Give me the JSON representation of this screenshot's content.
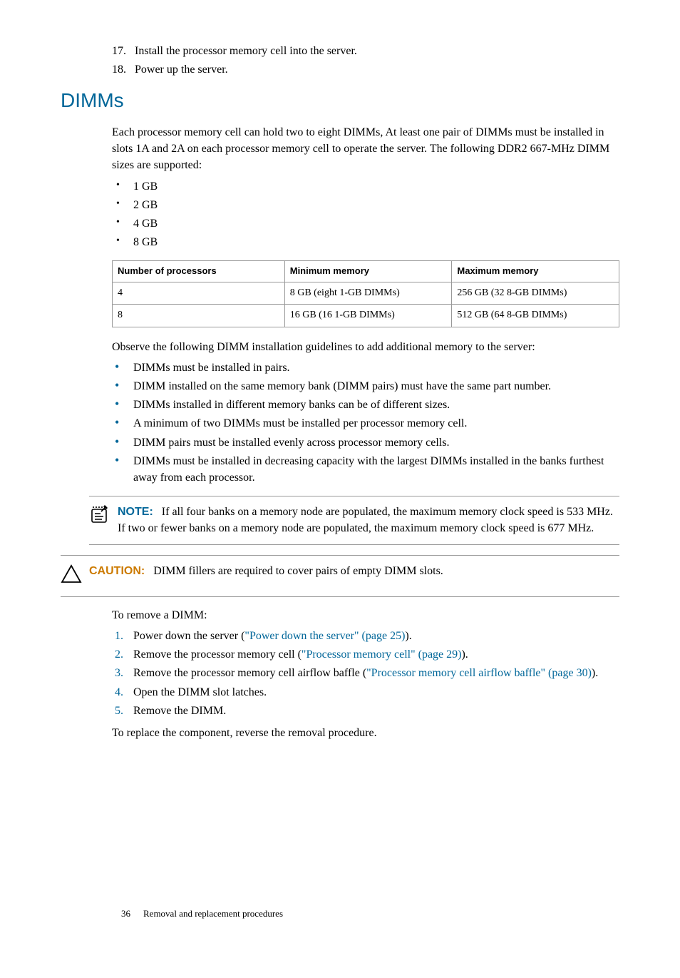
{
  "intro_steps": [
    {
      "num": "17.",
      "text": "Install the processor memory cell into the server."
    },
    {
      "num": "18.",
      "text": "Power up the server."
    }
  ],
  "heading": "DIMMs",
  "intro_para": "Each processor memory cell can hold two to eight DIMMs, At least one pair of DIMMs must be installed in slots 1A and 2A on each processor memory cell to operate the server. The following DDR2 667-MHz DIMM sizes are supported:",
  "size_bullets": [
    "1 GB",
    "2 GB",
    "4 GB",
    "8 GB"
  ],
  "table": {
    "headers": [
      "Number of processors",
      "Minimum memory",
      "Maximum memory"
    ],
    "rows": [
      [
        "4",
        "8 GB (eight 1-GB DIMMs)",
        "256 GB (32 8-GB DIMMs)"
      ],
      [
        "8",
        "16 GB (16 1-GB DIMMs)",
        "512 GB (64 8-GB DIMMs)"
      ]
    ]
  },
  "guidelines_intro": "Observe the following DIMM installation guidelines to add additional memory to the server:",
  "guidelines": [
    "DIMMs must be installed in pairs.",
    "DIMM installed on the same memory bank (DIMM pairs) must have the same part number.",
    "DIMMs installed in different memory banks can be of different sizes.",
    "A minimum of two DIMMs must be installed per processor memory cell.",
    "DIMM pairs must be installed evenly across processor memory cells.",
    "DIMMs must be installed in decreasing capacity with the largest DIMMs installed in the banks furthest away from each processor."
  ],
  "note": {
    "label": "NOTE:",
    "text": "If all four banks on a memory node are populated, the maximum memory clock speed is 533 MHz. If two or fewer banks on a memory node are populated, the maximum memory clock speed is 677 MHz."
  },
  "caution": {
    "label": "CAUTION:",
    "text": "DIMM fillers are required to cover pairs of empty DIMM slots."
  },
  "remove_intro": "To remove a DIMM:",
  "remove_steps": [
    {
      "num": "1.",
      "pre": "Power down the server (",
      "link": "\"Power down the server\" (page 25)",
      "post": ")."
    },
    {
      "num": "2.",
      "pre": "Remove the processor memory cell (",
      "link": "\"Processor memory cell\" (page 29)",
      "post": ")."
    },
    {
      "num": "3.",
      "pre": "Remove the processor memory cell airflow baffle (",
      "link": "\"Processor memory cell airflow baffle\" (page 30)",
      "post": ")."
    },
    {
      "num": "4.",
      "pre": "Open the DIMM slot latches.",
      "link": "",
      "post": ""
    },
    {
      "num": "5.",
      "pre": "Remove the DIMM.",
      "link": "",
      "post": ""
    }
  ],
  "replace_text": "To replace the component, reverse the removal procedure.",
  "footer": {
    "page": "36",
    "section": "Removal and replacement procedures"
  }
}
